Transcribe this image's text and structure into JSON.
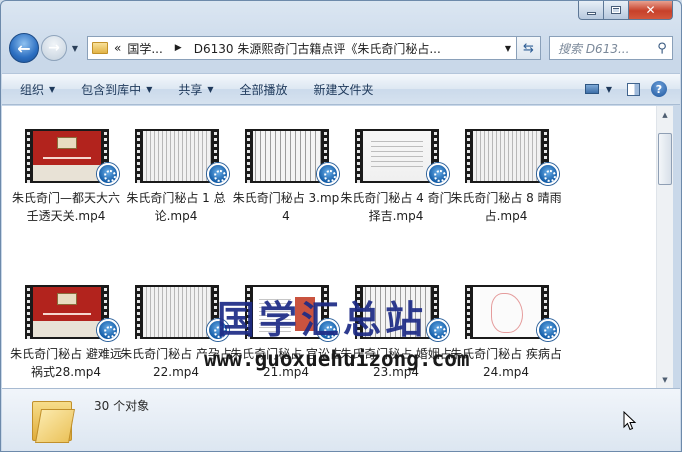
{
  "nav": {
    "breadcrumb": [
      "«",
      "国学...",
      "D6130 朱源熙奇门古籍点评《朱氏奇门秘占..."
    ],
    "search_placeholder": "搜索 D613..."
  },
  "toolbar": {
    "organize": "组织",
    "include_library": "包含到库中",
    "share": "共享",
    "play_all": "全部播放",
    "new_folder": "新建文件夹"
  },
  "files": [
    {
      "name": "朱氏奇门—都天大六壬透天关.mp4",
      "thumb": "red"
    },
    {
      "name": "朱氏奇门秘占 1 总论.mp4",
      "thumb": "scan"
    },
    {
      "name": "朱氏奇门秘占 3.mp4",
      "thumb": "scan2"
    },
    {
      "name": "朱氏奇门秘占 4 奇门择吉.mp4",
      "thumb": "doc"
    },
    {
      "name": "朱氏奇门秘占 8 晴雨占.mp4",
      "thumb": "scan"
    },
    {
      "name": "朱氏奇门秘占 避难远祸式28.mp4",
      "thumb": "red"
    },
    {
      "name": "朱氏奇门秘占 产孕占22.mp4",
      "thumb": "scan"
    },
    {
      "name": "朱氏奇门秘占 官讼占21.mp4",
      "thumb": "page"
    },
    {
      "name": "朱氏奇门秘占 婚姻占23.mp4",
      "thumb": "scan2"
    },
    {
      "name": "朱氏奇门秘占 疾病占24.mp4",
      "thumb": "sketch"
    }
  ],
  "watermark": {
    "title": "国学汇总站",
    "url": "www.guoxuehuizong.com"
  },
  "status": {
    "count": "30 个对象"
  }
}
